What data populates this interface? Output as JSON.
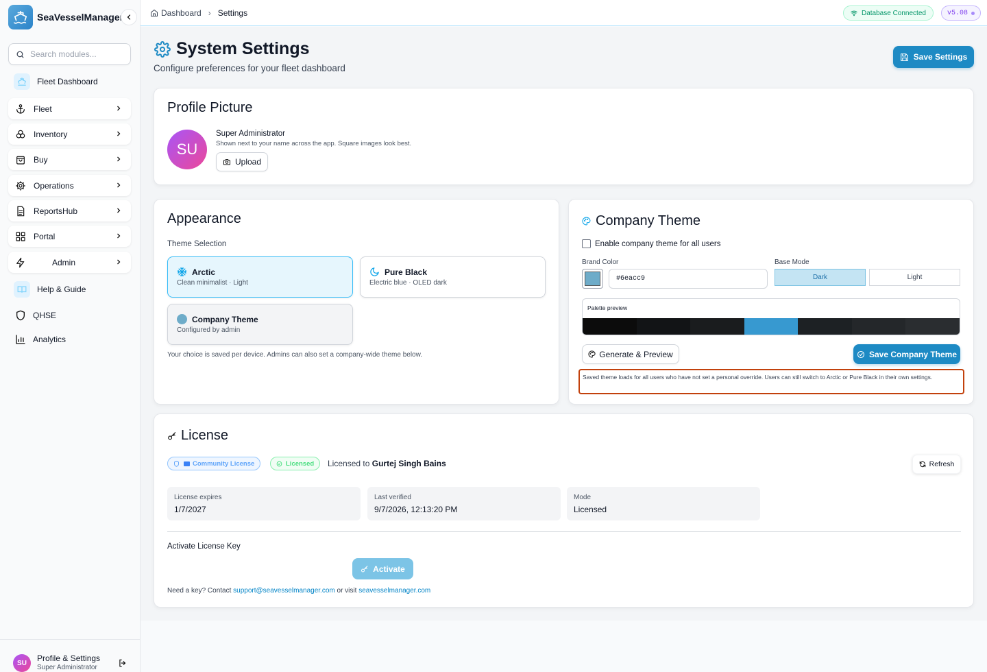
{
  "app": {
    "name": "SeaVesselManager"
  },
  "sidebar": {
    "search_placeholder": "Search modules...",
    "fleet_dashboard": "Fleet Dashboard",
    "groups": [
      {
        "label": "Fleet",
        "icon": "anchor-icon"
      },
      {
        "label": "Inventory",
        "icon": "boxes-icon"
      },
      {
        "label": "Buy",
        "icon": "shopping-bag-icon"
      },
      {
        "label": "Operations",
        "icon": "cog-icon"
      },
      {
        "label": "ReportsHub",
        "icon": "document-icon"
      },
      {
        "label": "Portal",
        "icon": "grid-icon"
      },
      {
        "label": "Admin",
        "icon": "bolt-icon"
      }
    ],
    "help": "Help & Guide",
    "qhse": "QHSE",
    "analytics": "Analytics",
    "profile": {
      "initials": "SU",
      "title": "Profile & Settings",
      "role": "Super Administrator"
    }
  },
  "topbar": {
    "breadcrumb": [
      "Dashboard",
      "Settings"
    ],
    "db_status": "Database Connected",
    "version": "v5.08"
  },
  "page": {
    "title": "System Settings",
    "subtitle": "Configure preferences for your fleet dashboard",
    "save_label": "Save Settings"
  },
  "profile_picture": {
    "heading": "Profile Picture",
    "initials": "SU",
    "name": "Super Administrator",
    "hint": "Shown next to your name across the app. Square images look best.",
    "upload_label": "Upload"
  },
  "appearance": {
    "heading": "Appearance",
    "section_label": "Theme Selection",
    "options": [
      {
        "title": "Arctic",
        "subtitle": "Clean minimalist · Light",
        "selected": true
      },
      {
        "title": "Pure Black",
        "subtitle": "Electric blue · OLED dark",
        "selected": false
      },
      {
        "title": "Company Theme",
        "subtitle": "Configured by admin",
        "selected": false
      }
    ],
    "note": "Your choice is saved per device. Admins can also set a company-wide theme below."
  },
  "company_theme": {
    "heading": "Company Theme",
    "enable_label": "Enable company theme for all users",
    "enabled": false,
    "brand_color_label": "Brand Color",
    "brand_color": "#6eacc9",
    "base_mode_label": "Base Mode",
    "modes": [
      "Dark",
      "Light"
    ],
    "selected_mode": "Dark",
    "palette_label": "Palette preview",
    "palette": [
      "#0c0c0c",
      "#121416",
      "#1a1c1e",
      "#3799d0",
      "#1d2124",
      "#24272a",
      "#2a2d30"
    ],
    "generate_label": "Generate & Preview",
    "save_label": "Save Company Theme",
    "note": "Saved theme loads for all users who have not set a personal override. Users can still switch to Arctic or Pure Black in their own settings."
  },
  "license": {
    "heading": "License",
    "badge_type": "Community License",
    "badge_status": "Licensed",
    "licensed_to_prefix": "Licensed to",
    "licensee": "Gurtej Singh Bains",
    "refresh_label": "Refresh",
    "tiles": [
      {
        "label": "License expires",
        "value": "1/7/2027"
      },
      {
        "label": "Last verified",
        "value": "9/7/2026, 12:13:20 PM"
      },
      {
        "label": "Mode",
        "value": "Licensed"
      }
    ],
    "activate_heading": "Activate License Key",
    "activate_label": "Activate",
    "help_prefix": "Need a key? Contact",
    "email": "support@seavesselmanager.com",
    "help_mid": "or visit",
    "site": "seavesselmanager.com"
  },
  "colors": {
    "accent": "#1d8ac4",
    "highlight_border": "#c2410c",
    "success": "#059669",
    "version": "#7c3aed"
  }
}
